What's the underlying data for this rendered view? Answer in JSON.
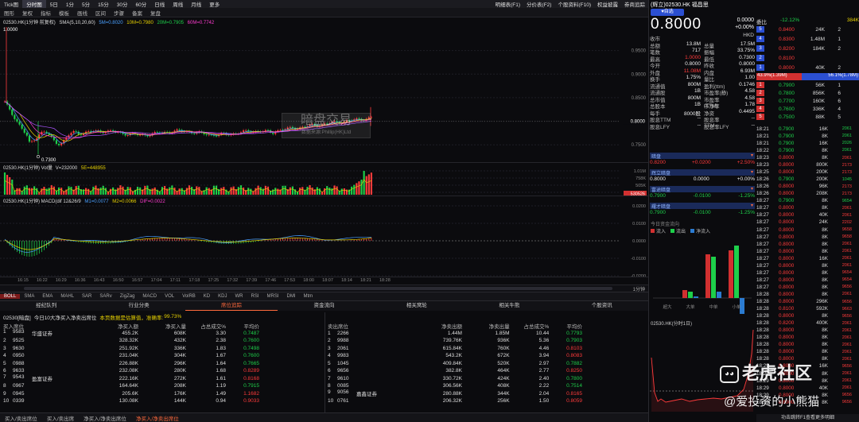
{
  "titlebar": {
    "items": [
      "Tick图",
      "分时图",
      "5日",
      "1分",
      "5分",
      "15分",
      "30分",
      "60分",
      "日线",
      "周线",
      "月线",
      "更多"
    ],
    "active_index": 1
  },
  "right_top_tabs": [
    "明细表(F1)",
    "分价表(F2)",
    "个股资料(F10)",
    "权益披露",
    "券商追踪"
  ],
  "toolbar": {
    "items": [
      "图形",
      "复权",
      "指标",
      "模板",
      "画线",
      "区间",
      "步骤",
      "备案",
      "复盘"
    ]
  },
  "main_chart": {
    "header_code": "02530.HK(1分钟 前复权)",
    "ma_label": "SMA(5,10,20,60)",
    "ma_values": [
      "5M=0.8020",
      "10M=0.7980",
      "20M=0.7905",
      "60M=0.7742"
    ],
    "ma_colors": [
      "#4aa0ff",
      "#e6d000",
      "#ff3bd0",
      "#aa55ff"
    ],
    "high_marker": "1.0000",
    "low_marker": "0.7300",
    "yticks": [
      "0.9500",
      "0.9000",
      "0.8500",
      "0.8000",
      "0.7500"
    ],
    "current_price_tag": "0.8000",
    "watermark_title": "暗盘交易",
    "watermark_sub": "数据来源:Phillip(HK)Ltd"
  },
  "vol_chart": {
    "header": "02530.HK(1分钟) Vol量",
    "v_label": "V=232000",
    "ma_label": "5E=448955",
    "yticks": [
      "1.01M",
      "758K",
      "505K",
      "252K"
    ],
    "current_tag": "530526"
  },
  "macd_chart": {
    "header": "02530.HK(1分钟) MACD(dif 12&26/9",
    "m1": "M1=0.0077",
    "m2": "M2=0.0066",
    "dif": "DIF=0.0022",
    "yticks": [
      "0.0200",
      "0.0100",
      "0.0000",
      "-0.0100",
      "-0.0200"
    ]
  },
  "time_axis": {
    "ticks": [
      "16:15",
      "16:22",
      "16:29",
      "16:36",
      "16:43",
      "16:50",
      "16:57",
      "17:04",
      "17:11",
      "17:18",
      "17:25",
      "17:32",
      "17:39",
      "17:46",
      "17:53",
      "18:00",
      "18:07",
      "18:14",
      "18:21",
      "18:28"
    ],
    "scale_label": "1分钟"
  },
  "indicator_row": {
    "items": [
      "BOLL",
      "SMA",
      "EMA",
      "MAHL",
      "SAR",
      "SARv",
      "ZigZag",
      "MACD",
      "VOL",
      "VolRB",
      "KD",
      "KDJ",
      "WR",
      "RSI",
      "MRSI",
      "DMI",
      "Mtm"
    ],
    "active_index": 0
  },
  "section_tabs": {
    "items": [
      "经纪队列",
      "行业分类",
      "席位追踪",
      "资金流向",
      "相关窝轮",
      "相关牛熊",
      "个股资讯"
    ],
    "active_index": 2
  },
  "broker_info": {
    "code": "02530[暗盘]",
    "summary": "今日10大净买入净卖出席位",
    "note": "本页数据是估算值，准确率:",
    "accuracy": "99.73%"
  },
  "buy_table": {
    "headers": [
      "买入席位",
      "净买入额",
      "净买入量",
      "占总成交%",
      "平均价"
    ],
    "rows": [
      {
        "rank": "1",
        "code": "9583",
        "name": "华盛证券",
        "amount": "455.2K",
        "qty": "608K",
        "pct": "3.30",
        "avg": "0.7487",
        "avg_color": "green"
      },
      {
        "rank": "2",
        "code": "9525",
        "name": "",
        "amount": "328.32K",
        "qty": "432K",
        "pct": "2.38",
        "avg": "0.7600",
        "avg_color": "green"
      },
      {
        "rank": "3",
        "code": "9630",
        "name": "",
        "amount": "251.92K",
        "qty": "336K",
        "pct": "1.83",
        "avg": "0.7498",
        "avg_color": "green"
      },
      {
        "rank": "4",
        "code": "0950",
        "name": "",
        "amount": "231.04K",
        "qty": "304K",
        "pct": "1.67",
        "avg": "0.7600",
        "avg_color": "green"
      },
      {
        "rank": "5",
        "code": "0988",
        "name": "",
        "amount": "226.88K",
        "qty": "296K",
        "pct": "1.64",
        "avg": "0.7665",
        "avg_color": "green"
      },
      {
        "rank": "6",
        "code": "9633",
        "name": "",
        "amount": "232.08K",
        "qty": "280K",
        "pct": "1.68",
        "avg": "0.8289",
        "avg_color": "red"
      },
      {
        "rank": "7",
        "code": "9543",
        "name": "盈富证券",
        "amount": "222.16K",
        "qty": "272K",
        "pct": "1.61",
        "avg": "0.8168",
        "avg_color": "red"
      },
      {
        "rank": "8",
        "code": "0967",
        "name": "",
        "amount": "164.64K",
        "qty": "208K",
        "pct": "1.19",
        "avg": "0.7915",
        "avg_color": "green"
      },
      {
        "rank": "9",
        "code": "0945",
        "name": "",
        "amount": "205.6K",
        "qty": "176K",
        "pct": "1.49",
        "avg": "1.1682",
        "avg_color": "red"
      },
      {
        "rank": "10",
        "code": "0339",
        "name": "",
        "amount": "130.08K",
        "qty": "144K",
        "pct": "0.94",
        "avg": "0.9033",
        "avg_color": "red"
      }
    ]
  },
  "sell_table": {
    "headers": [
      "卖出席位",
      "净卖出额",
      "净卖出量",
      "占总成交%",
      "平均价"
    ],
    "rows": [
      {
        "rank": "1",
        "code": "2266",
        "name": "",
        "amount": "1.44M",
        "qty": "1.85M",
        "pct": "10.44",
        "avg": "0.7793",
        "avg_color": "green"
      },
      {
        "rank": "2",
        "code": "9988",
        "name": "",
        "amount": "739.76K",
        "qty": "936K",
        "pct": "5.36",
        "avg": "0.7903",
        "avg_color": "green"
      },
      {
        "rank": "3",
        "code": "2061",
        "name": "",
        "amount": "615.84K",
        "qty": "760K",
        "pct": "4.46",
        "avg": "0.8103",
        "avg_color": "red"
      },
      {
        "rank": "4",
        "code": "9983",
        "name": "",
        "amount": "543.2K",
        "qty": "672K",
        "pct": "3.94",
        "avg": "0.8083",
        "avg_color": "red"
      },
      {
        "rank": "5",
        "code": "1045",
        "name": "",
        "amount": "409.84K",
        "qty": "520K",
        "pct": "2.97",
        "avg": "0.7882",
        "avg_color": "green"
      },
      {
        "rank": "6",
        "code": "9656",
        "name": "",
        "amount": "382.8K",
        "qty": "464K",
        "pct": "2.77",
        "avg": "0.8250",
        "avg_color": "red"
      },
      {
        "rank": "7",
        "code": "9610",
        "name": "",
        "amount": "330.72K",
        "qty": "424K",
        "pct": "2.40",
        "avg": "0.7800",
        "avg_color": "green"
      },
      {
        "rank": "8",
        "code": "0085",
        "name": "",
        "amount": "306.56K",
        "qty": "408K",
        "pct": "2.22",
        "avg": "0.7514",
        "avg_color": "green"
      },
      {
        "rank": "9",
        "code": "9056",
        "name": "嘉鑫证券",
        "amount": "280.88K",
        "qty": "344K",
        "pct": "2.04",
        "avg": "0.8165",
        "avg_color": "red"
      },
      {
        "rank": "10",
        "code": "0761",
        "name": "",
        "amount": "206.32K",
        "qty": "256K",
        "pct": "1.50",
        "avg": "0.8059",
        "avg_color": "red"
      }
    ]
  },
  "bottom_tabs": {
    "items": [
      "买入/卖出席位",
      "买入/卖出席",
      "净买入/净卖出席位",
      "净买入/净卖出席位"
    ],
    "active_index": 3
  },
  "quote": {
    "name_line": "(辉立)02530.HK  福昌思",
    "badge": "自选",
    "price": "0.8000",
    "change": "0.0000",
    "change_pct": "+0.00%",
    "currency": "HKD",
    "left_rows": [
      {
        "k": "收市",
        "v": "",
        "v_color": "white",
        "k2": "",
        "v2": ""
      },
      {
        "k": "总额",
        "v": "13.8M",
        "v_color": "white",
        "k2": "总量",
        "v2": "17.5M"
      },
      {
        "k": "笔数",
        "v": "717",
        "v_color": "white",
        "k2": "振幅",
        "v2": "33.75%"
      },
      {
        "k": "最高",
        "v": "1.0000",
        "v_color": "red",
        "k2": "最低",
        "v2": "0.7300"
      },
      {
        "k": "今开",
        "v": "0.8000",
        "v_color": "white",
        "k2": "昨收",
        "v2": "0.8000"
      },
      {
        "k": "外盘",
        "v": "11.08M",
        "v_color": "red",
        "k2": "内盘",
        "v2": "6.93M"
      },
      {
        "k": "换手",
        "v": "1.75%",
        "v_color": "white",
        "k2": "量比",
        "v2": "1.00"
      },
      {
        "k": "流通值",
        "v": "800M",
        "v_color": "white",
        "k2": "盈利(ttm)",
        "v2": "0.1746"
      },
      {
        "k": "流通股",
        "v": "1B",
        "v_color": "white",
        "k2": "市盈率(静)",
        "v2": "4.58"
      },
      {
        "k": "总市值",
        "v": "800M",
        "v_color": "white",
        "k2": "市盈率(TTM)",
        "v2": "4.58"
      },
      {
        "k": "总股本",
        "v": "1B",
        "v_color": "white",
        "k2": "市净率",
        "v2": "1.78"
      },
      {
        "k": "每手",
        "v": "8000股",
        "v_color": "white",
        "k2": "净资",
        "v2": "0.4495"
      },
      {
        "k": "股息TTM",
        "v": "--",
        "v_color": "white",
        "k2": "股息率TTM",
        "v2": "--"
      },
      {
        "k": "股息LFY",
        "v": "--",
        "v_color": "white",
        "k2": "股息率LFY",
        "v2": "--"
      }
    ],
    "dark_pool": [
      {
        "label": "暗盘",
        "price": "0.8200",
        "chg": "+0.0200",
        "pct": "+2.50%",
        "color": "red"
      },
      {
        "label": "辉立暗盘",
        "price": "0.8000",
        "chg": "0.0000",
        "pct": "+0.00%",
        "color": "white"
      },
      {
        "label": "富途暗盘",
        "price": "0.7900",
        "chg": "-0.0100",
        "pct": "-1.25%",
        "color": "green"
      },
      {
        "label": "耀才暗盘",
        "price": "0.7900",
        "chg": "-0.0100",
        "pct": "-1.25%",
        "color": "green"
      }
    ],
    "fund_flow_title": "今日资金流向",
    "fund_flow_legend": [
      "流入",
      "流出",
      "净流入"
    ],
    "fund_flow_xlabels": [
      "超大",
      "大单",
      "中单",
      "小单"
    ],
    "mini_chart_title": "02530.HK(分时1日)"
  },
  "order_book": {
    "ratio_label": "委比",
    "ratio_value": "-12.12%",
    "ratio_right": "384K",
    "asks": [
      {
        "lvl": "5",
        "px": "0.8400",
        "vol": "24K",
        "cnt": "2"
      },
      {
        "lvl": "4",
        "px": "0.8300",
        "vol": "1.48M",
        "cnt": "1"
      },
      {
        "lvl": "3",
        "px": "0.8200",
        "vol": "184K",
        "cnt": "2"
      },
      {
        "lvl": "2",
        "px": "0.8100",
        "vol": "",
        "cnt": ""
      },
      {
        "lvl": "1",
        "px": "0.8000",
        "vol": "40K",
        "cnt": "2"
      }
    ],
    "bar_left": "43.9%(1.39M)",
    "bar_right": "56.1%(1.78M)",
    "bids": [
      {
        "lvl": "1",
        "px": "0.7900",
        "vol": "56K",
        "cnt": "1"
      },
      {
        "lvl": "2",
        "px": "0.7800",
        "vol": "856K",
        "cnt": "6"
      },
      {
        "lvl": "3",
        "px": "0.7700",
        "vol": "160K",
        "cnt": "6"
      },
      {
        "lvl": "4",
        "px": "0.7600",
        "vol": "336K",
        "cnt": "4"
      },
      {
        "lvl": "5",
        "px": "0.7500",
        "vol": "88K",
        "cnt": "5"
      }
    ]
  },
  "ticks": [
    {
      "t": "18:21",
      "p": "0.7900",
      "v": "16K",
      "s": "2061",
      "c": "green"
    },
    {
      "t": "18:21",
      "p": "0.7900",
      "v": "8K",
      "s": "2061",
      "c": "green"
    },
    {
      "t": "18:21",
      "p": "0.7900",
      "v": "16K",
      "s": "2026",
      "c": "green"
    },
    {
      "t": "18:22",
      "p": "0.7900",
      "v": "8K",
      "s": "2061",
      "c": "green"
    },
    {
      "t": "18:23",
      "p": "0.8000",
      "v": "8K",
      "s": "2061",
      "c": "red"
    },
    {
      "t": "18:23",
      "p": "0.8000",
      "v": "800K",
      "s": "2173",
      "c": "red"
    },
    {
      "t": "18:25",
      "p": "0.8000",
      "v": "200K",
      "s": "2173",
      "c": "red"
    },
    {
      "t": "18:26",
      "p": "0.7900",
      "v": "200K",
      "s": "1045",
      "c": "green"
    },
    {
      "t": "18:26",
      "p": "0.8000",
      "v": "96K",
      "s": "2173",
      "c": "red"
    },
    {
      "t": "18:26",
      "p": "0.8000",
      "v": "208K",
      "s": "2173",
      "c": "red"
    },
    {
      "t": "18:27",
      "p": "0.7900",
      "v": "8K",
      "s": "9654",
      "c": "green"
    },
    {
      "t": "18:27",
      "p": "0.8000",
      "v": "8K",
      "s": "2061",
      "c": "red"
    },
    {
      "t": "18:27",
      "p": "0.8000",
      "v": "40K",
      "s": "2061",
      "c": "red"
    },
    {
      "t": "18:27",
      "p": "0.8000",
      "v": "24K",
      "s": "2202",
      "c": "red"
    },
    {
      "t": "18:27",
      "p": "0.8000",
      "v": "8K",
      "s": "9658",
      "c": "red"
    },
    {
      "t": "18:27",
      "p": "0.8000",
      "v": "8K",
      "s": "9658",
      "c": "red"
    },
    {
      "t": "18:27",
      "p": "0.8000",
      "v": "8K",
      "s": "2061",
      "c": "red"
    },
    {
      "t": "18:27",
      "p": "0.8000",
      "v": "8K",
      "s": "2061",
      "c": "red"
    },
    {
      "t": "18:27",
      "p": "0.8000",
      "v": "16K",
      "s": "2061",
      "c": "red"
    },
    {
      "t": "18:27",
      "p": "0.8000",
      "v": "8K",
      "s": "2061",
      "c": "red"
    },
    {
      "t": "18:27",
      "p": "0.8000",
      "v": "8K",
      "s": "9654",
      "c": "red"
    },
    {
      "t": "18:27",
      "p": "0.8000",
      "v": "8K",
      "s": "9654",
      "c": "red"
    },
    {
      "t": "18:27",
      "p": "0.8000",
      "v": "8K",
      "s": "9656",
      "c": "red"
    },
    {
      "t": "18:28",
      "p": "0.8000",
      "v": "8K",
      "s": "2061",
      "c": "red"
    },
    {
      "t": "18:28",
      "p": "0.8000",
      "v": "296K",
      "s": "9656",
      "c": "red"
    },
    {
      "t": "18:28",
      "p": "0.8100",
      "v": "592K",
      "s": "9663",
      "c": "red"
    },
    {
      "t": "18:28",
      "p": "0.8000",
      "v": "8K",
      "s": "9656",
      "c": "red"
    },
    {
      "t": "18:28",
      "p": "0.8200",
      "v": "400K",
      "s": "2061",
      "c": "red"
    },
    {
      "t": "18:28",
      "p": "0.8000",
      "v": "8K",
      "s": "2061",
      "c": "red"
    },
    {
      "t": "18:28",
      "p": "0.8000",
      "v": "8K",
      "s": "2061",
      "c": "red"
    },
    {
      "t": "18:28",
      "p": "0.8000",
      "v": "8K",
      "s": "2061",
      "c": "red"
    },
    {
      "t": "18:28",
      "p": "0.8000",
      "v": "8K",
      "s": "2061",
      "c": "red"
    },
    {
      "t": "18:28",
      "p": "0.8000",
      "v": "8K",
      "s": "2061",
      "c": "red"
    },
    {
      "t": "18:29",
      "p": "0.8000",
      "v": "16K",
      "s": "9656",
      "c": "red"
    },
    {
      "t": "18:29",
      "p": "0.8000",
      "v": "8K",
      "s": "2061",
      "c": "red"
    },
    {
      "t": "18:29",
      "p": "0.8000",
      "v": "8K",
      "s": "2061",
      "c": "red"
    },
    {
      "t": "18:29",
      "p": "0.8000",
      "v": "40K",
      "s": "2061",
      "c": "red"
    },
    {
      "t": "18:29",
      "p": "0.8000",
      "v": "8K",
      "s": "9656",
      "c": "red"
    },
    {
      "t": "18:29",
      "p": "0.8000",
      "v": "8K",
      "s": "9656",
      "c": "red"
    }
  ],
  "footer_right": "功击跳转F1查看更多明细",
  "watermark_overlay": {
    "title": "老虎社区",
    "sub": "@爱投资的小熊猫"
  },
  "colors": {
    "up": "#ff3b3b",
    "down": "#1ecf4a",
    "accent": "#ff6a3d"
  }
}
